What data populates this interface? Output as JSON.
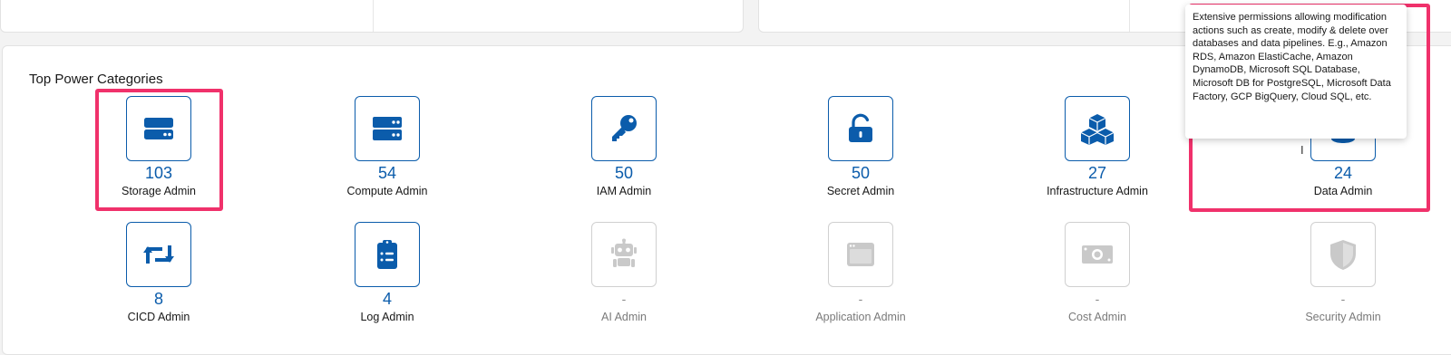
{
  "section_title": "Top Power Categories",
  "tooltip_text": "Extensive permissions allowing modification actions such as create, modify & delete over databases and data pipelines. E.g., Amazon RDS, Amazon ElastiCache, Amazon DynamoDB, Microsoft SQL Database, Microsoft DB for PostgreSQL, Microsoft Data Factory, GCP BigQuery, Cloud SQL, etc.",
  "cursor_glyph": "I",
  "categories": [
    {
      "count": "103",
      "label": "Storage Admin",
      "icon": "storage-icon",
      "active": true
    },
    {
      "count": "54",
      "label": "Compute Admin",
      "icon": "server-icon",
      "active": true
    },
    {
      "count": "50",
      "label": "IAM Admin",
      "icon": "key-icon",
      "active": true
    },
    {
      "count": "50",
      "label": "Secret Admin",
      "icon": "unlock-icon",
      "active": true
    },
    {
      "count": "27",
      "label": "Infrastructure Admin",
      "icon": "cubes-icon",
      "active": true
    },
    {
      "count": "24",
      "label": "Data Admin",
      "icon": "database-icon",
      "active": true
    },
    {
      "count": "8",
      "label": "CICD Admin",
      "icon": "retweet-icon",
      "active": true
    },
    {
      "count": "4",
      "label": "Log Admin",
      "icon": "clipboard-list-icon",
      "active": true
    },
    {
      "count": "-",
      "label": "AI Admin",
      "icon": "robot-icon",
      "active": false
    },
    {
      "count": "-",
      "label": "Application Admin",
      "icon": "window-icon",
      "active": false
    },
    {
      "count": "-",
      "label": "Cost Admin",
      "icon": "money-bill-icon",
      "active": false
    },
    {
      "count": "-",
      "label": "Security Admin",
      "icon": "shield-icon",
      "active": false
    }
  ],
  "colors": {
    "accent": "#0b5cab",
    "highlight": "#f0316b",
    "disabled": "#c9c9c9"
  }
}
